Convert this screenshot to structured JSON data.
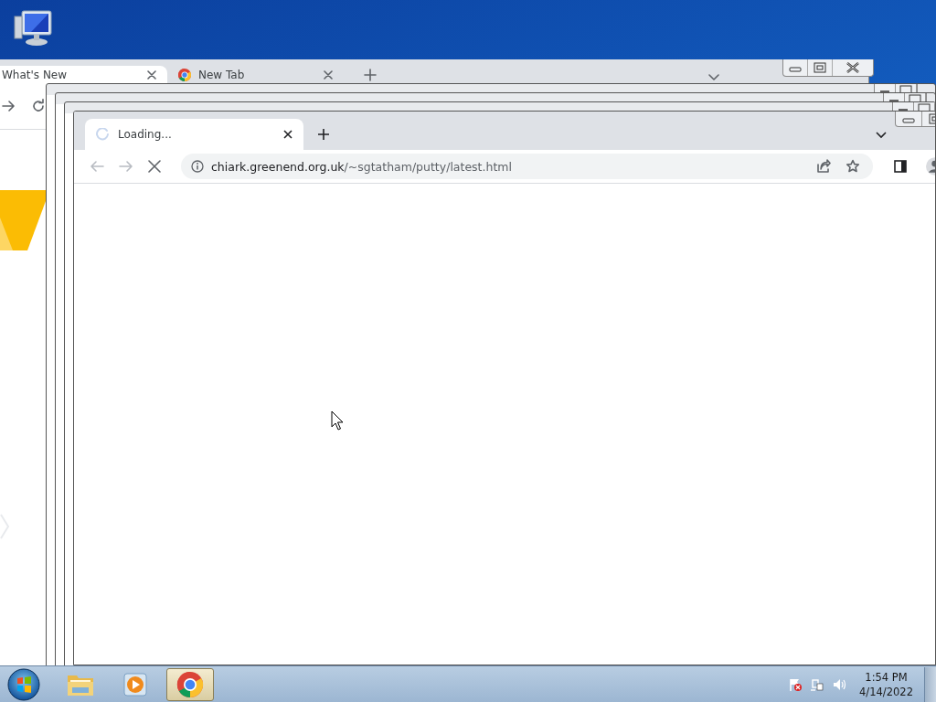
{
  "back_window": {
    "tabs": [
      {
        "title": "What's New",
        "selected": true,
        "kind": "page"
      },
      {
        "title": "New Tab",
        "selected": false,
        "kind": "chrome"
      }
    ]
  },
  "front_window": {
    "tabs": [
      {
        "title": "Loading...",
        "selected": true,
        "loading": true
      }
    ],
    "address": {
      "domain": "chiark.greenend.org.uk",
      "path": "/~sgtatham/putty/latest.html"
    }
  },
  "taskbar": {
    "apps": [
      {
        "kind": "explorer",
        "active": false
      },
      {
        "kind": "media",
        "active": false
      },
      {
        "kind": "chrome",
        "active": true
      }
    ],
    "clock": {
      "time": "1:54 PM",
      "date": "4/14/2022"
    }
  }
}
